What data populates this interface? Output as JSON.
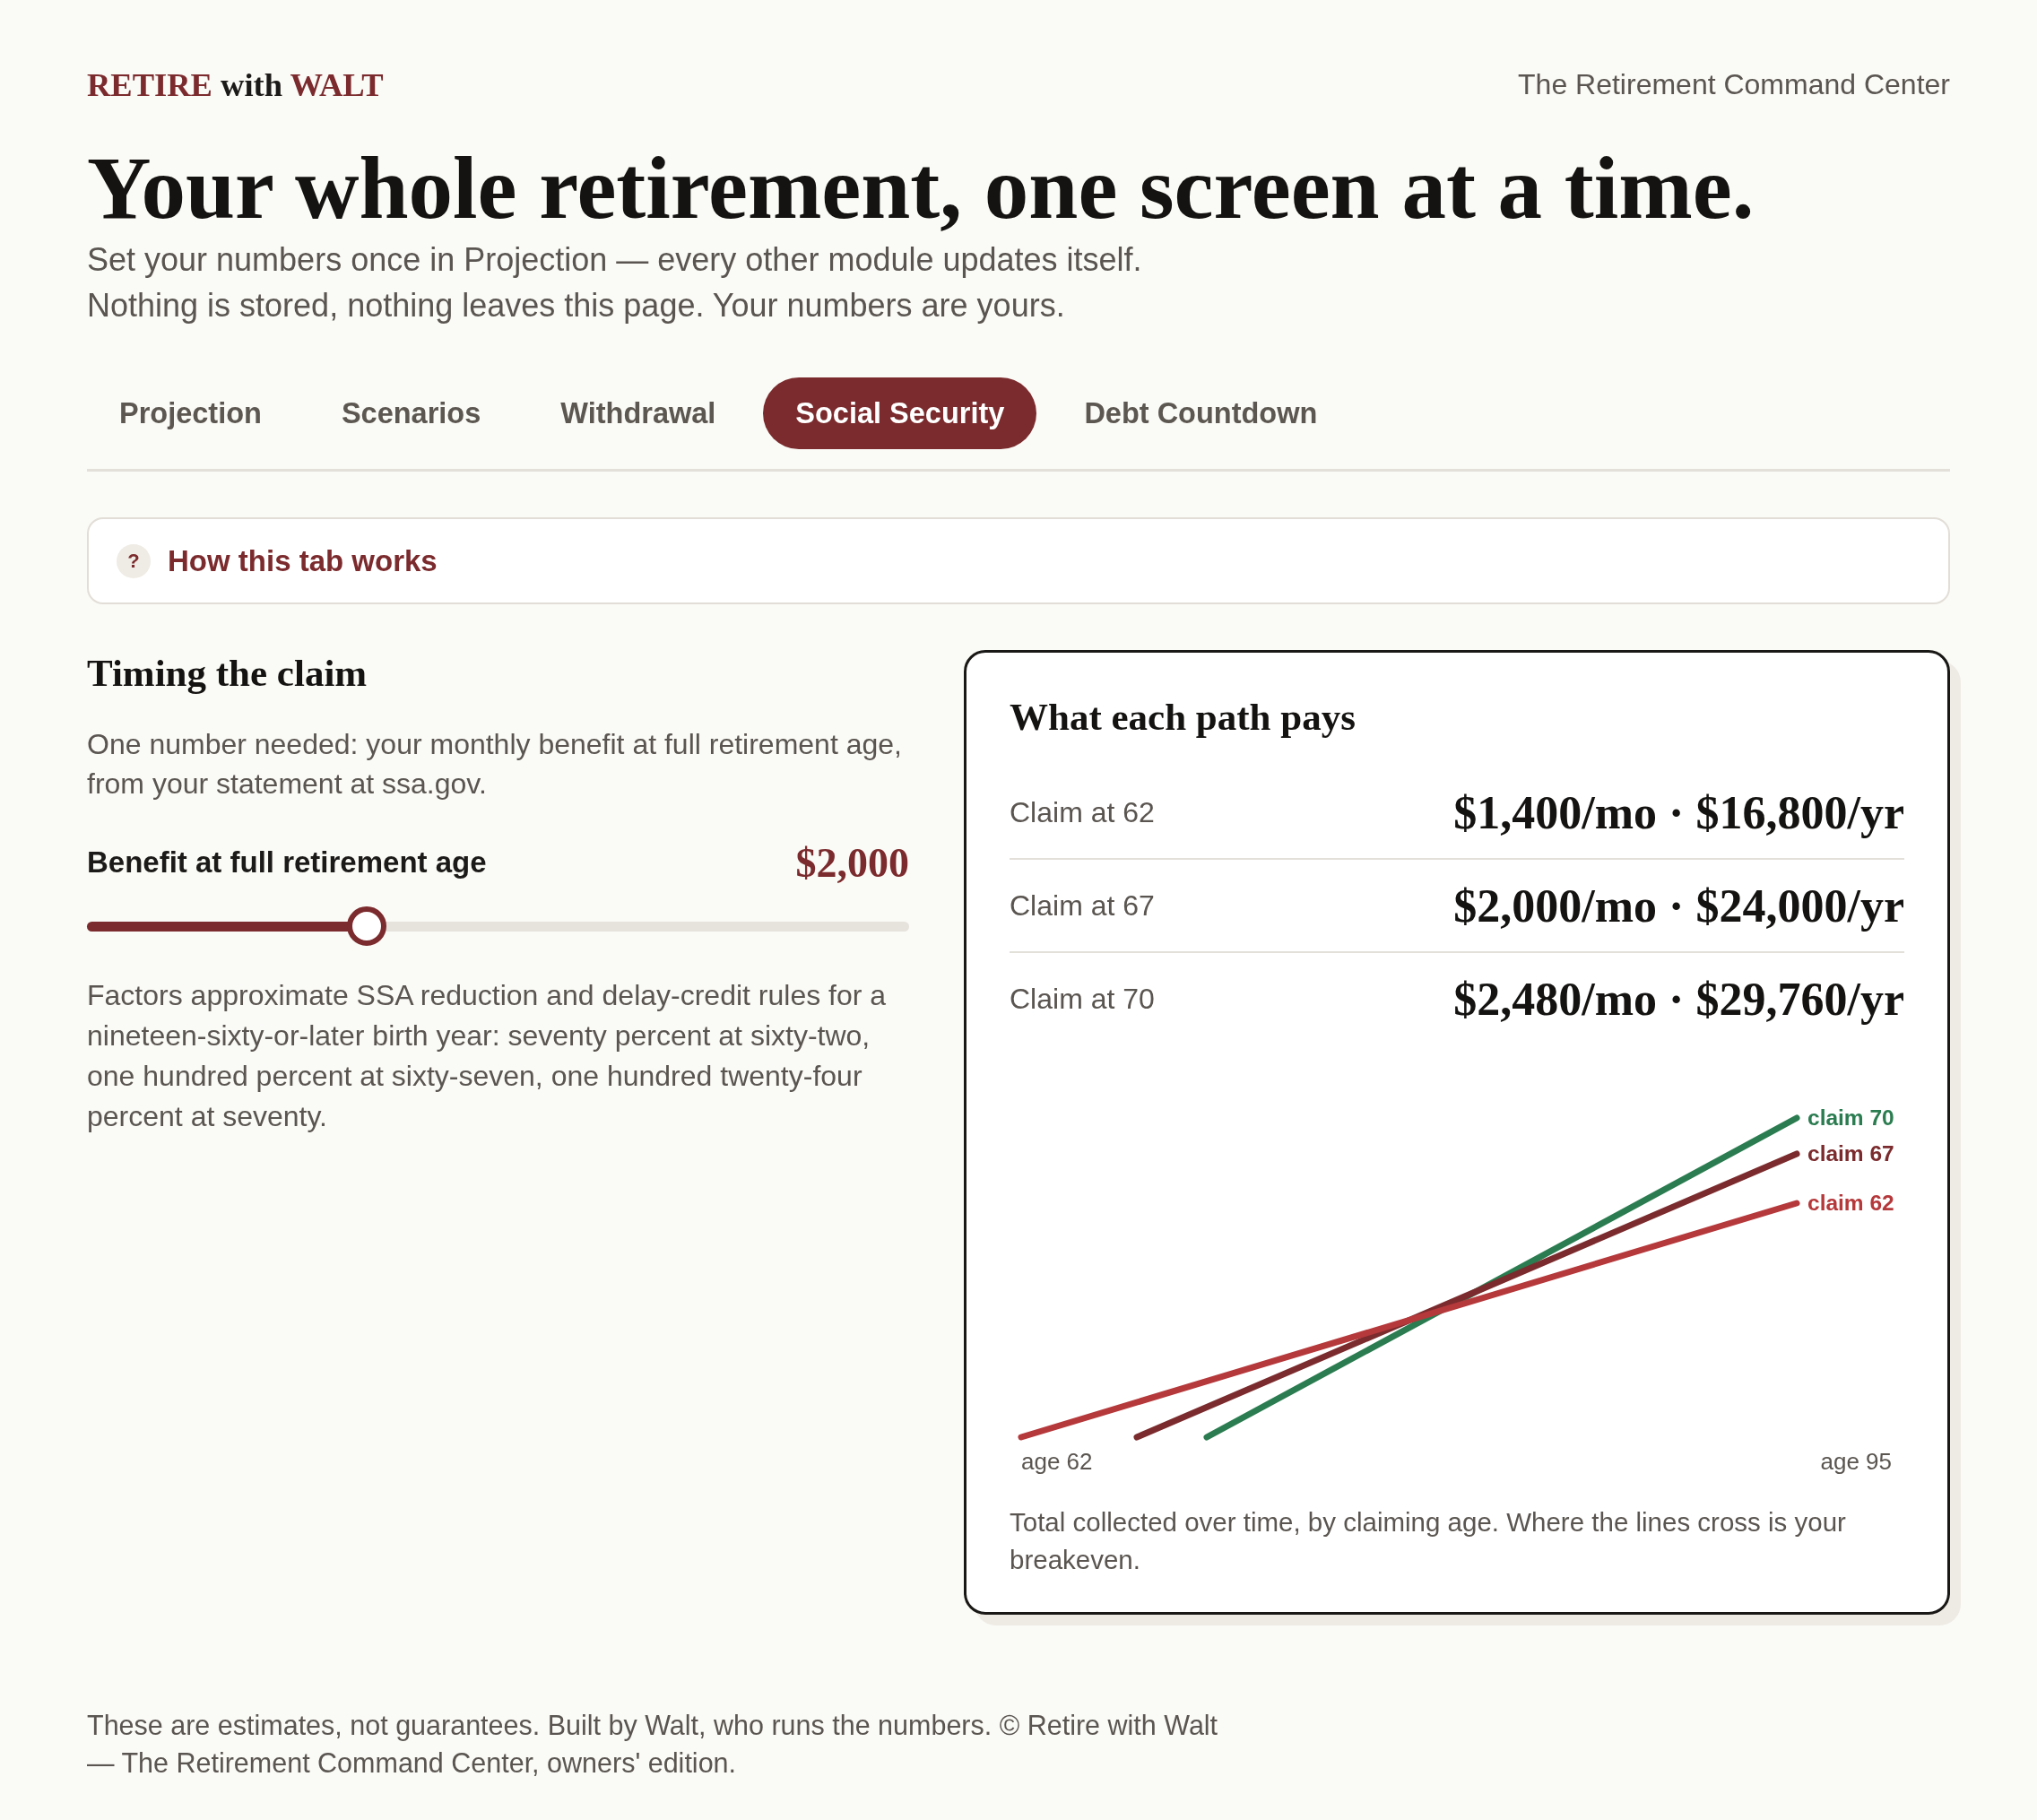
{
  "header": {
    "brand": {
      "lead": "RETIRE",
      "joiner": "with",
      "name": "WALT"
    },
    "tagline": "The Retirement Command Center"
  },
  "hero": {
    "title": "Your whole retirement, one screen at a time.",
    "lines": [
      "Set your numbers once in Projection — every other module updates itself.",
      "Nothing is stored, nothing leaves this page. Your numbers are yours."
    ]
  },
  "tabs": [
    {
      "label": "Projection",
      "selected": false
    },
    {
      "label": "Scenarios",
      "selected": false
    },
    {
      "label": "Withdrawal",
      "selected": false
    },
    {
      "label": "Social Security",
      "selected": true
    },
    {
      "label": "Debt Countdown",
      "selected": false
    }
  ],
  "help": {
    "icon": "?",
    "label": "How this tab works"
  },
  "timing": {
    "title": "Timing the claim",
    "intro": "One number needed: your monthly benefit at full retirement age, from your statement at ssa.gov.",
    "slider": {
      "label": "Benefit at full retirement age",
      "value": "$2,000",
      "level": 0.34
    },
    "note": "Factors approximate SSA reduction and delay-credit rules for a nineteen-sixty-or-later birth year: seventy percent at sixty-two, one hundred percent at sixty-seven, one hundred twenty-four percent at seventy."
  },
  "paths": {
    "title": "What each path pays",
    "rows": [
      {
        "label": "Claim at 62",
        "value": "$1,400/mo · $16,800/yr"
      },
      {
        "label": "Claim at 67",
        "value": "$2,000/mo · $24,000/yr"
      },
      {
        "label": "Claim at 70",
        "value": "$2,480/mo · $29,760/yr"
      }
    ],
    "chart": {
      "start_label": "age 62",
      "end_label": "age 95",
      "lines": [
        {
          "label": "claim 70",
          "color": "#2b7c50"
        },
        {
          "label": "claim 67",
          "color": "#7b2b2d"
        },
        {
          "label": "claim 62",
          "color": "#b5383b"
        }
      ]
    },
    "caption": "Total collected over time, by claiming age. Where the lines cross is your breakeven."
  },
  "footer": {
    "text": "These are estimates, not guarantees. Built by Walt, who runs the numbers. © Retire with Walt — The Retirement Command Center, owners' edition."
  }
}
